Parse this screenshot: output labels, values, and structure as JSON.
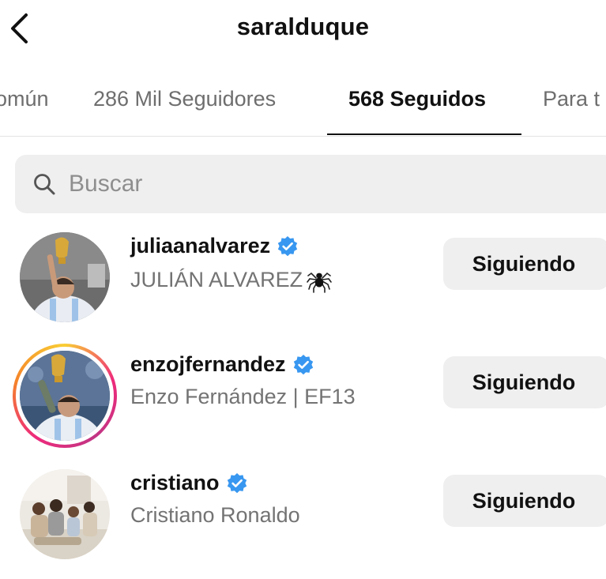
{
  "header": {
    "title": "saralduque",
    "back_icon": "chevron-left-icon"
  },
  "tabs": [
    {
      "label": "omún",
      "active": false
    },
    {
      "label": "286 Mil Seguidores",
      "active": false
    },
    {
      "label": "568 Seguidos",
      "active": true
    },
    {
      "label": "Para t",
      "active": false
    }
  ],
  "search": {
    "placeholder": "Buscar",
    "icon": "search-icon"
  },
  "users": [
    {
      "username": "juliaanalvarez",
      "full_name": "JULIÁN ALVAREZ",
      "verified": true,
      "has_story_ring": false,
      "name_emoji": "spider-icon",
      "follow_label": "Siguiendo"
    },
    {
      "username": "enzojfernandez",
      "full_name": "Enzo Fernández | EF13",
      "verified": true,
      "has_story_ring": true,
      "follow_label": "Siguiendo"
    },
    {
      "username": "cristiano",
      "full_name": "Cristiano Ronaldo",
      "verified": true,
      "has_story_ring": false,
      "follow_label": "Siguiendo"
    }
  ],
  "colors": {
    "verified_blue": "#3897f0",
    "button_bg": "#efefef",
    "secondary_text": "#737373",
    "story_ring_start": "#f9ce34",
    "story_ring_end": "#ee2a7b"
  }
}
